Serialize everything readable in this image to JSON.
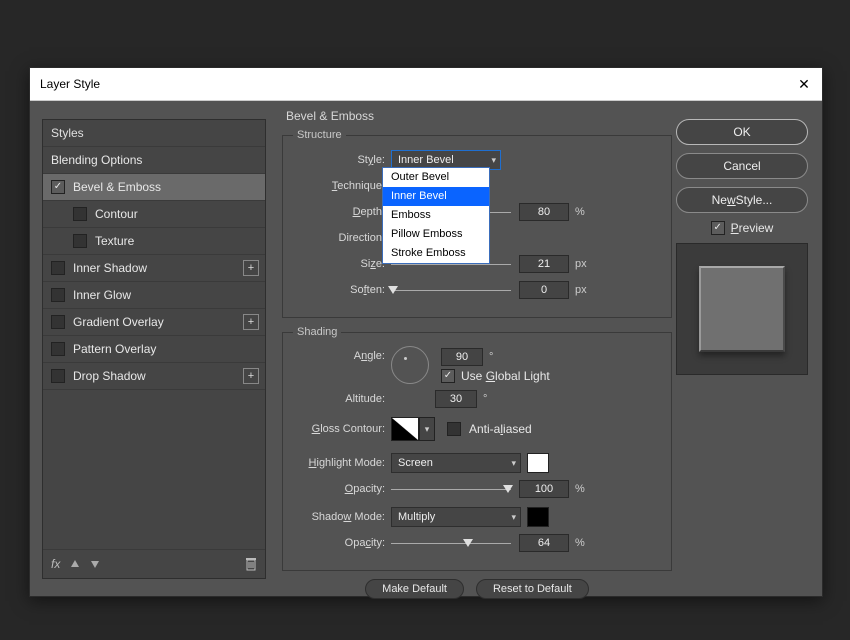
{
  "title": "Layer Style",
  "left": {
    "styles": "Styles",
    "blending": "Blending Options",
    "bevel": "Bevel & Emboss",
    "contour": "Contour",
    "texture": "Texture",
    "innerShadow": "Inner Shadow",
    "innerGlow": "Inner Glow",
    "gradientOverlay": "Gradient Overlay",
    "patternOverlay": "Pattern Overlay",
    "dropShadow": "Drop Shadow"
  },
  "center": {
    "header": "Bevel & Emboss",
    "structure": {
      "legend": "Structure",
      "styleLabel": "Style:",
      "styleValue": "Inner Bevel",
      "styleOptions": [
        "Outer Bevel",
        "Inner Bevel",
        "Emboss",
        "Pillow Emboss",
        "Stroke Emboss"
      ],
      "techniqueLabel": "Technique:",
      "depthLabel": "Depth:",
      "depthValue": "80",
      "depthUnit": "%",
      "directionLabel": "Direction:",
      "sizeLabel": "Size:",
      "sizeValue": "21",
      "sizeUnit": "px",
      "softenLabel": "Soften:",
      "softenValue": "0",
      "softenUnit": "px"
    },
    "shading": {
      "legend": "Shading",
      "angleLabel": "Angle:",
      "angleValue": "90",
      "angleUnit": "°",
      "globalLight": "Use Global Light",
      "altitudeLabel": "Altitude:",
      "altitudeValue": "30",
      "altitudeUnit": "°",
      "glossLabel": "Gloss Contour:",
      "antiAliased": "Anti-aliased",
      "highlightModeLabel": "Highlight Mode:",
      "highlightModeValue": "Screen",
      "hOpacityLabel": "Opacity:",
      "hOpacityValue": "100",
      "hOpacityUnit": "%",
      "shadowModeLabel": "Shadow Mode:",
      "shadowModeValue": "Multiply",
      "sOpacityLabel": "Opacity:",
      "sOpacityValue": "64",
      "sOpacityUnit": "%"
    },
    "makeDefault": "Make Default",
    "resetDefault": "Reset to Default"
  },
  "right": {
    "ok": "OK",
    "cancel": "Cancel",
    "newStyle": "New Style...",
    "preview": "Preview"
  },
  "fxLabel": "fx"
}
